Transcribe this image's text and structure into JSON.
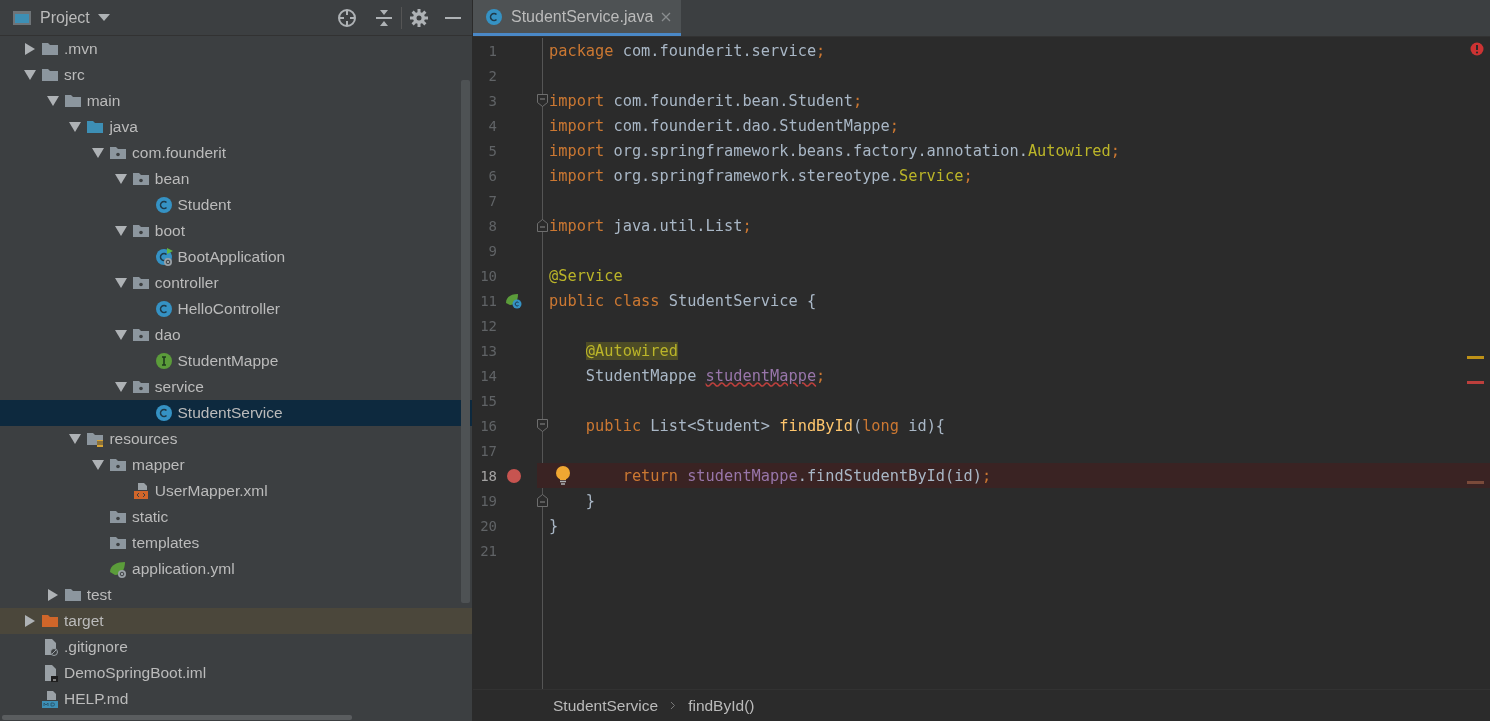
{
  "project_panel": {
    "title": "Project",
    "tree": [
      {
        "label": ".mvn",
        "kind": "folder",
        "expanded": false,
        "selected": false
      },
      {
        "label": "src",
        "kind": "folder",
        "expanded": true,
        "selected": false,
        "children": [
          {
            "label": "main",
            "kind": "folder",
            "expanded": true,
            "selected": false,
            "children": [
              {
                "label": "java",
                "kind": "source-folder",
                "expanded": true,
                "selected": false,
                "children": [
                  {
                    "label": "com.founderit",
                    "kind": "package",
                    "expanded": true,
                    "selected": false,
                    "children": [
                      {
                        "label": "bean",
                        "kind": "package",
                        "expanded": true,
                        "selected": false,
                        "children": [
                          {
                            "label": "Student",
                            "kind": "class",
                            "selected": false
                          }
                        ]
                      },
                      {
                        "label": "boot",
                        "kind": "package",
                        "expanded": true,
                        "selected": false,
                        "children": [
                          {
                            "label": "BootApplication",
                            "kind": "spring-class",
                            "selected": false
                          }
                        ]
                      },
                      {
                        "label": "controller",
                        "kind": "package",
                        "expanded": true,
                        "selected": false,
                        "children": [
                          {
                            "label": "HelloController",
                            "kind": "class",
                            "selected": false
                          }
                        ]
                      },
                      {
                        "label": "dao",
                        "kind": "package",
                        "expanded": true,
                        "selected": false,
                        "children": [
                          {
                            "label": "StudentMappe",
                            "kind": "interface",
                            "selected": false
                          }
                        ]
                      },
                      {
                        "label": "service",
                        "kind": "package",
                        "expanded": true,
                        "selected": false,
                        "children": [
                          {
                            "label": "StudentService",
                            "kind": "class",
                            "selected": true
                          }
                        ]
                      }
                    ]
                  }
                ]
              },
              {
                "label": "resources",
                "kind": "resources",
                "expanded": true,
                "selected": false,
                "children": [
                  {
                    "label": "mapper",
                    "kind": "package",
                    "expanded": true,
                    "selected": false,
                    "children": [
                      {
                        "label": "UserMapper.xml",
                        "kind": "xml",
                        "selected": false
                      }
                    ]
                  },
                  {
                    "label": "static",
                    "kind": "package",
                    "selected": false
                  },
                  {
                    "label": "templates",
                    "kind": "package",
                    "selected": false
                  },
                  {
                    "label": "application.yml",
                    "kind": "yml",
                    "selected": false
                  }
                ]
              }
            ]
          },
          {
            "label": "test",
            "kind": "folder",
            "expanded": false,
            "selected": false
          }
        ]
      },
      {
        "label": "target",
        "kind": "excluded-folder",
        "expanded": false,
        "selected": false
      },
      {
        "label": ".gitignore",
        "kind": "ignore-file",
        "selected": false
      },
      {
        "label": "DemoSpringBoot.iml",
        "kind": "module-file",
        "selected": false
      },
      {
        "label": "HELP.md",
        "kind": "markdown",
        "selected": false
      }
    ]
  },
  "editor": {
    "tabs": [
      {
        "label": "StudentService.java",
        "selected": true
      }
    ],
    "lines": [
      {
        "number": "1",
        "kind": "plain",
        "tokens": [
          {
            "kind": "keyword",
            "text": "package "
          },
          {
            "kind": "plain",
            "text": "com.founderit.service"
          },
          {
            "kind": "keyword",
            "text": ";"
          }
        ]
      },
      {
        "number": "2",
        "kind": "plain"
      },
      {
        "number": "3",
        "kind": "fold-start",
        "tokens": [
          {
            "kind": "keyword",
            "text": "import "
          },
          {
            "kind": "plain",
            "text": "com.founderit.bean.Student"
          },
          {
            "kind": "keyword",
            "text": ";"
          }
        ]
      },
      {
        "number": "4",
        "kind": "plain",
        "tokens": [
          {
            "kind": "keyword",
            "text": "import "
          },
          {
            "kind": "plain",
            "text": "com.founderit.dao.StudentMappe"
          },
          {
            "kind": "keyword",
            "text": ";"
          }
        ]
      },
      {
        "number": "5",
        "kind": "plain",
        "tokens": [
          {
            "kind": "keyword",
            "text": "import "
          },
          {
            "kind": "plain",
            "text": "org.springframework.beans.factory.annotation."
          },
          {
            "kind": "annotation",
            "text": "Autowired"
          },
          {
            "kind": "keyword",
            "text": ";"
          }
        ]
      },
      {
        "number": "6",
        "kind": "plain",
        "tokens": [
          {
            "kind": "keyword",
            "text": "import "
          },
          {
            "kind": "plain",
            "text": "org.springframework.stereotype."
          },
          {
            "kind": "annotation",
            "text": "Service"
          },
          {
            "kind": "keyword",
            "text": ";"
          }
        ]
      },
      {
        "number": "7",
        "kind": "plain"
      },
      {
        "number": "8",
        "kind": "fold-end",
        "tokens": [
          {
            "kind": "keyword",
            "text": "import "
          },
          {
            "kind": "plain",
            "text": "java.util.List"
          },
          {
            "kind": "keyword",
            "text": ";"
          }
        ]
      },
      {
        "number": "9",
        "kind": "plain"
      },
      {
        "number": "10",
        "kind": "plain",
        "tokens": [
          {
            "kind": "annotation",
            "text": "@Service"
          }
        ]
      },
      {
        "number": "11",
        "kind": "bean",
        "tokens": [
          {
            "kind": "keyword",
            "text": "public class "
          },
          {
            "kind": "plain",
            "text": "StudentService {"
          }
        ]
      },
      {
        "number": "12",
        "kind": "plain"
      },
      {
        "number": "13",
        "kind": "plain",
        "tokens": [
          {
            "kind": "annotation-highlight",
            "text": "    @Autowired"
          }
        ]
      },
      {
        "number": "14",
        "kind": "plain",
        "tokens": [
          {
            "kind": "plain",
            "text": "    StudentMappe "
          },
          {
            "kind": "field-error",
            "text": "studentMappe"
          },
          {
            "kind": "keyword",
            "text": ";"
          }
        ]
      },
      {
        "number": "15",
        "kind": "plain"
      },
      {
        "number": "16",
        "kind": "fold-start",
        "tokens": [
          {
            "kind": "keyword",
            "text": "    public "
          },
          {
            "kind": "plain",
            "text": "List<Student> "
          },
          {
            "kind": "method",
            "text": "findById"
          },
          {
            "kind": "plain",
            "text": "("
          },
          {
            "kind": "keyword",
            "text": "long "
          },
          {
            "kind": "plain",
            "text": "id){"
          }
        ]
      },
      {
        "number": "17",
        "kind": "plain"
      },
      {
        "number": "18",
        "kind": "breakpoint",
        "tokens": [
          {
            "kind": "keyword",
            "text": "        return "
          },
          {
            "kind": "field",
            "text": "studentMappe"
          },
          {
            "kind": "plain",
            "text": ".findStudentById(id)"
          },
          {
            "kind": "keyword",
            "text": ";"
          }
        ]
      },
      {
        "number": "19",
        "kind": "fold-end",
        "tokens": [
          {
            "kind": "plain",
            "text": "    }"
          }
        ]
      },
      {
        "number": "20",
        "kind": "plain",
        "tokens": [
          {
            "kind": "plain",
            "text": "}"
          }
        ]
      },
      {
        "number": "21",
        "kind": "plain"
      }
    ],
    "breadcrumbs": [
      "StudentService",
      "findById()"
    ]
  }
}
